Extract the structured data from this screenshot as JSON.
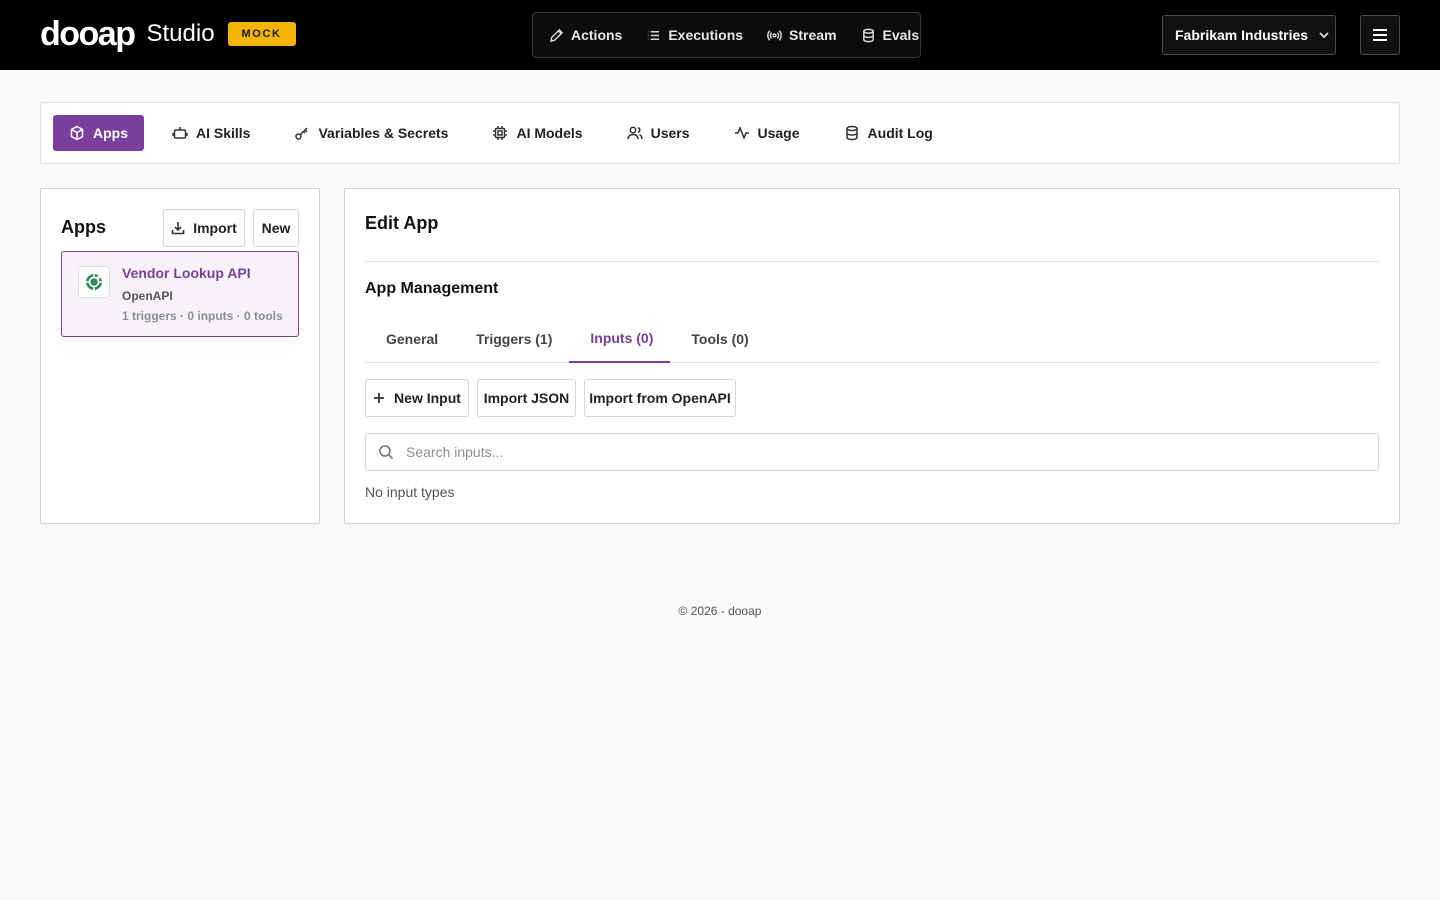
{
  "brand": {
    "logo": "dooap",
    "product": "Studio",
    "badge": "MOCK"
  },
  "topnav": {
    "items": [
      {
        "label": "Actions",
        "icon": "pencil-icon"
      },
      {
        "label": "Executions",
        "icon": "list-icon"
      },
      {
        "label": "Stream",
        "icon": "broadcast-icon"
      },
      {
        "label": "Evals",
        "icon": "database-icon"
      }
    ],
    "org": "Fabrikam Industries"
  },
  "section_tabs": [
    {
      "label": "Apps",
      "icon": "cube-icon",
      "active": true
    },
    {
      "label": "AI Skills",
      "icon": "robot-icon"
    },
    {
      "label": "Variables & Secrets",
      "icon": "key-icon"
    },
    {
      "label": "AI Models",
      "icon": "chip-icon"
    },
    {
      "label": "Users",
      "icon": "users-icon"
    },
    {
      "label": "Usage",
      "icon": "activity-icon"
    },
    {
      "label": "Audit Log",
      "icon": "database-icon"
    }
  ],
  "apps_panel": {
    "title": "Apps",
    "import_label": "Import",
    "new_label": "New",
    "apps": [
      {
        "name": "Vendor Lookup API",
        "type": "OpenAPI",
        "meta": "1 triggers · 0 inputs · 0 tools",
        "selected": true
      }
    ]
  },
  "edit_panel": {
    "title": "Edit App",
    "section_title": "App Management",
    "tabs": [
      {
        "label": "General"
      },
      {
        "label": "Triggers (1)"
      },
      {
        "label": "Inputs (0)",
        "active": true
      },
      {
        "label": "Tools (0)"
      }
    ],
    "new_input_label": "New Input",
    "import_json_label": "Import JSON",
    "import_openapi_label": "Import from OpenAPI",
    "search_placeholder": "Search inputs...",
    "empty_text": "No input types"
  },
  "footer": {
    "text": "© 2026 - dooap"
  },
  "colors": {
    "accent": "#7a3e9d",
    "badge": "#f5b400",
    "topbar": "#000000",
    "openapi_green": "#2e8b57"
  }
}
